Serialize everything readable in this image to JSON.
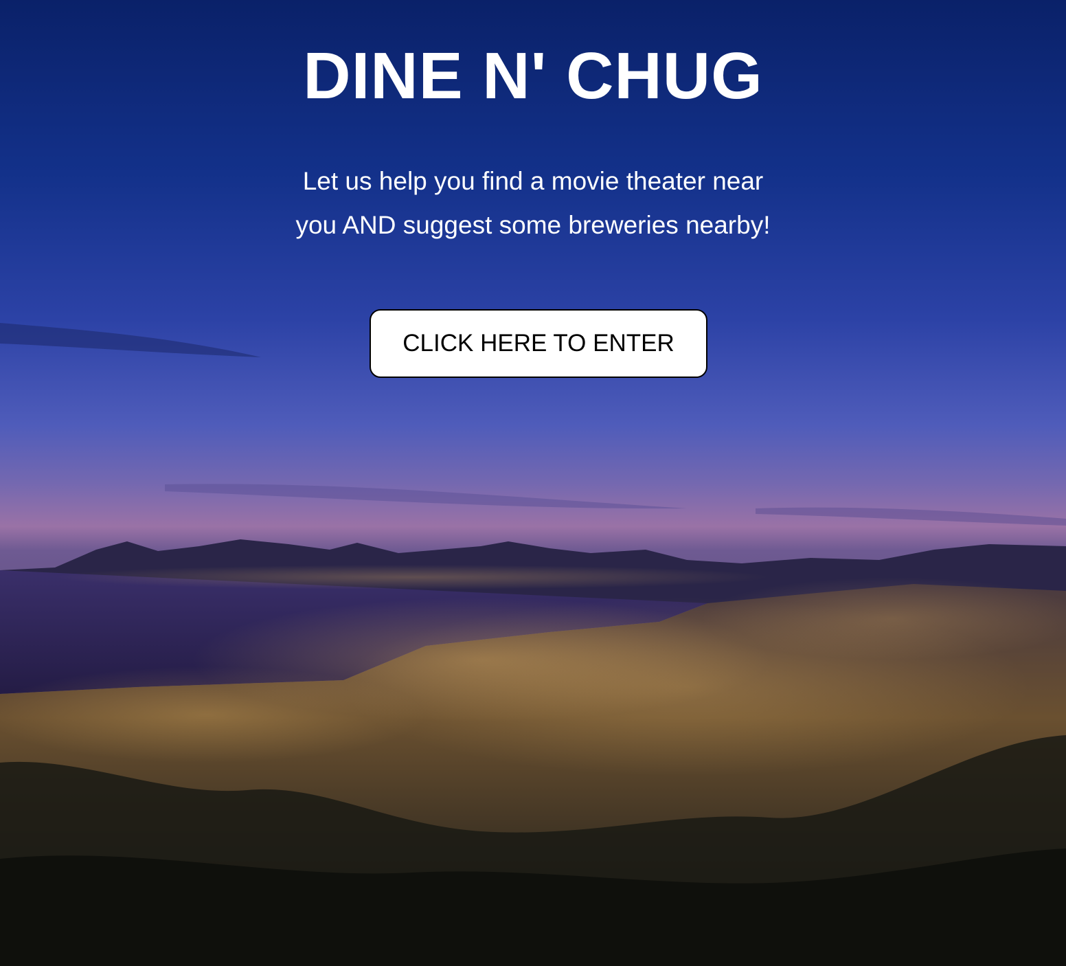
{
  "header": {
    "title": "DINE N' CHUG"
  },
  "hero": {
    "tagline_line1": "Let us help you find a movie theater near",
    "tagline_line2": "you AND suggest some breweries nearby!",
    "enter_button_label": "CLICK HERE TO ENTER",
    "background_icon": "night-city-photo"
  },
  "colors": {
    "sky_top": "#0c2570",
    "sky_mid": "#3b4ab0",
    "dusk": "#8a6aa8",
    "city_lights": "#f0b04a",
    "text": "#ffffff",
    "button_bg": "#ffffff",
    "button_text": "#000000"
  }
}
